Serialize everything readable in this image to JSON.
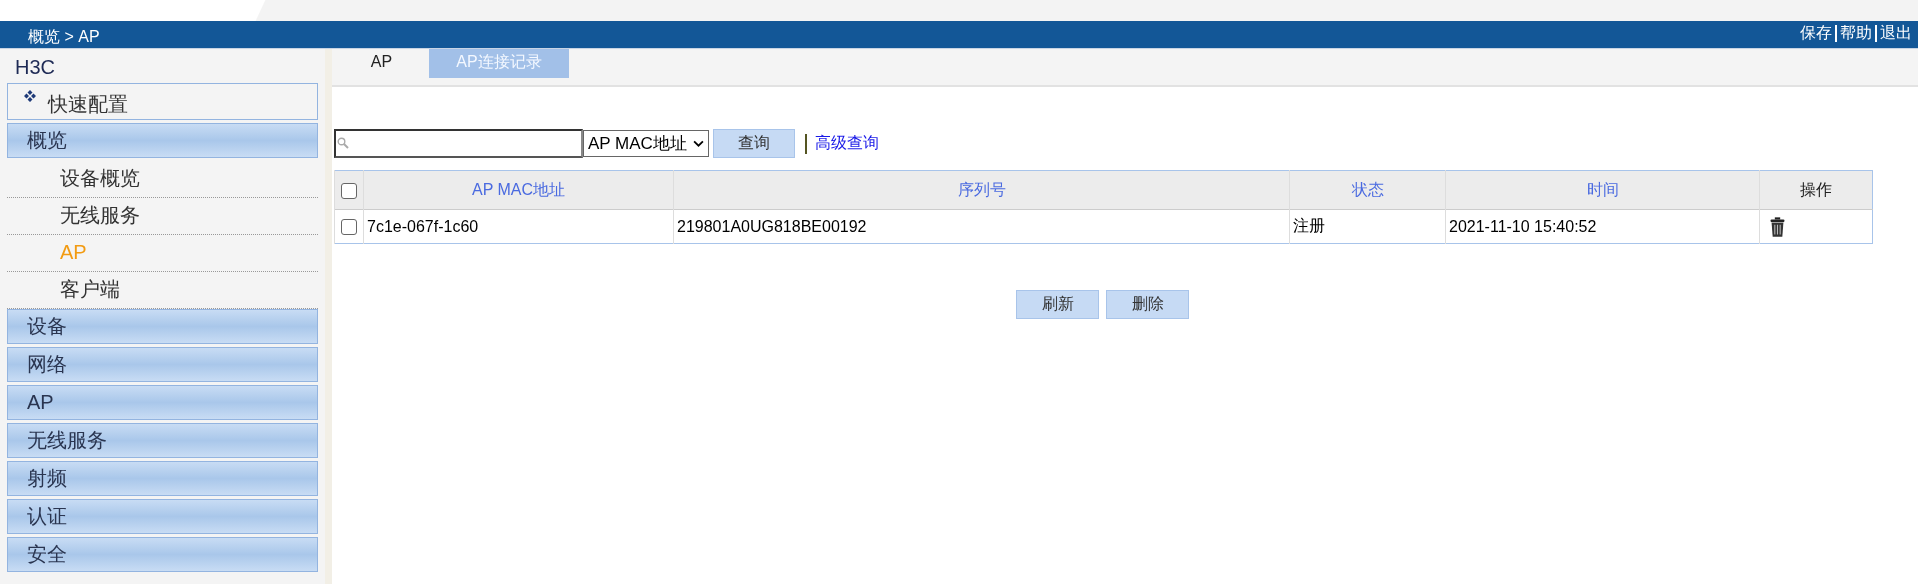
{
  "header": {
    "breadcrumb": "概览 > AP",
    "links": [
      {
        "label": "保存"
      },
      {
        "label": "帮助"
      },
      {
        "label": "退出"
      }
    ]
  },
  "sidebar": {
    "brand": "H3C",
    "quick_config": "快速配置",
    "groups": [
      {
        "label": "概览",
        "children": [
          {
            "label": "设备概览",
            "selected": false
          },
          {
            "label": "无线服务",
            "selected": false
          },
          {
            "label": "AP",
            "selected": true
          },
          {
            "label": "客户端",
            "selected": false
          }
        ]
      },
      {
        "label": "设备"
      },
      {
        "label": "网络"
      },
      {
        "label": "AP"
      },
      {
        "label": "无线服务"
      },
      {
        "label": "射频"
      },
      {
        "label": "认证"
      },
      {
        "label": "安全"
      }
    ]
  },
  "tabs": [
    {
      "label": "AP",
      "selected": true
    },
    {
      "label": "AP连接记录",
      "selected": false
    }
  ],
  "search": {
    "field_select": "AP MAC地址",
    "button": "查询",
    "advanced_link": "高级查询"
  },
  "table": {
    "header_checked": false,
    "columns": [
      "AP MAC地址",
      "序列号",
      "状态",
      "时间",
      "操作"
    ],
    "rows": [
      {
        "checked": false,
        "mac": "7c1e-067f-1c60",
        "serial": "219801A0UG818BE00192",
        "status": "注册",
        "time": "2021-11-10 15:40:52"
      }
    ]
  },
  "buttons": [
    {
      "label": "刷新"
    },
    {
      "label": "删除"
    }
  ]
}
